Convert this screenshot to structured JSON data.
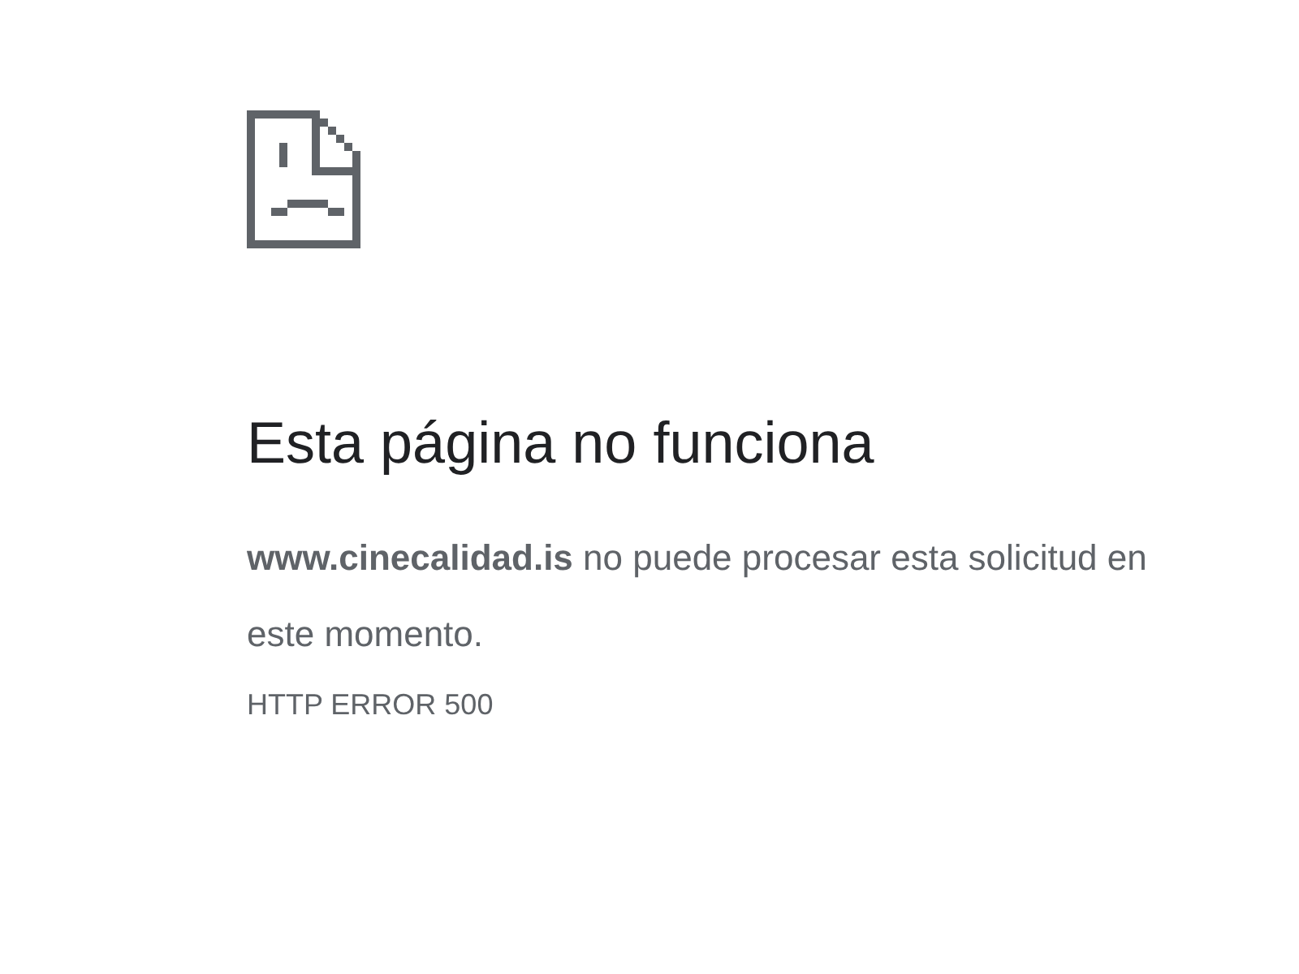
{
  "heading": "Esta página no funciona",
  "message": "**www.cinecalidad.is** no puede procesar esta solicitud en este momento.",
  "error_code": "HTTP ERROR 500"
}
